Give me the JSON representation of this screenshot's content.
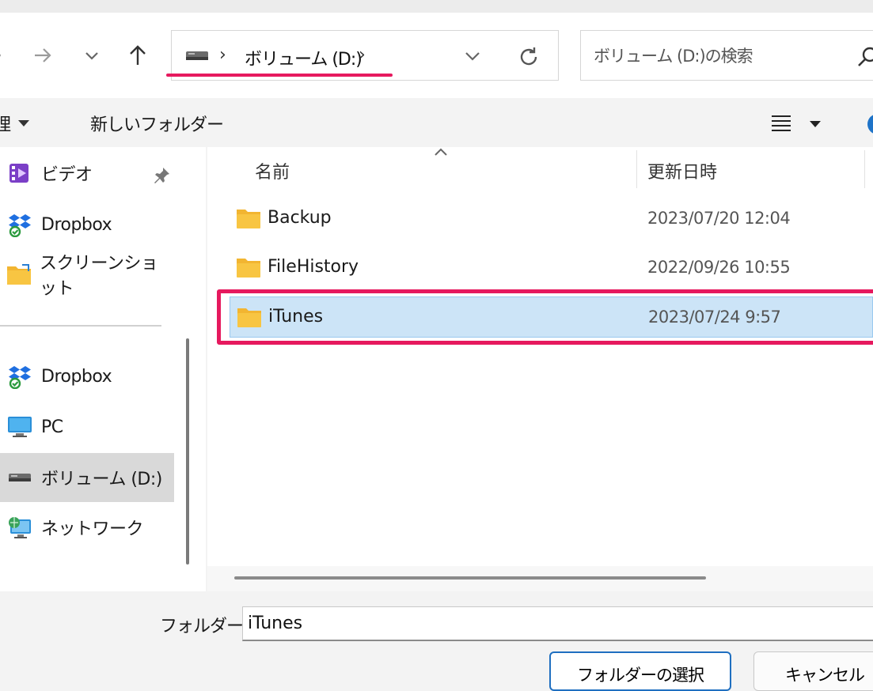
{
  "nav": {
    "back_icon": "arrow-left-icon",
    "forward_icon": "arrow-right-icon",
    "recent_icon": "chevron-down-icon",
    "up_icon": "arrow-up-icon",
    "address": {
      "drive_icon": "drive-icon",
      "separator": "›",
      "path": "ボリューム (D:)",
      "trailing_separator": "›"
    },
    "refresh_icon": "refresh-icon",
    "search": {
      "placeholder": "ボリューム (D:)の検索",
      "icon": "search-icon"
    }
  },
  "command_bar": {
    "organize_label": "理",
    "new_folder_label": "新しいフォルダー",
    "view_icon": "list-view-icon",
    "help_icon": "help-icon"
  },
  "sidebar": {
    "quick_access": [
      {
        "label": "ビデオ",
        "icon": "video-folder-icon",
        "pinned": true
      },
      {
        "label": "Dropbox",
        "icon": "dropbox-icon"
      },
      {
        "label": "スクリーンショット",
        "icon": "screenshot-folder-icon"
      }
    ],
    "locations": [
      {
        "label": "Dropbox",
        "icon": "dropbox-icon"
      },
      {
        "label": "PC",
        "icon": "pc-icon"
      },
      {
        "label": "ボリューム (D:)",
        "icon": "drive-icon",
        "selected": true
      },
      {
        "label": "ネットワーク",
        "icon": "network-icon"
      }
    ]
  },
  "file_list": {
    "columns": {
      "name": "名前",
      "modified": "更新日時"
    },
    "rows": [
      {
        "name": "Backup",
        "modified": "2023/07/20 12:04",
        "selected": false
      },
      {
        "name": "FileHistory",
        "modified": "2022/09/26 10:55",
        "selected": false
      },
      {
        "name": "iTunes",
        "modified": "2023/07/24 9:57",
        "selected": true
      }
    ]
  },
  "footer": {
    "folder_label": "フォルダー:",
    "folder_value": "iTunes",
    "select_button": "フォルダーの選択",
    "cancel_button": "キャンセル"
  },
  "colors": {
    "annotation": "#e6195e",
    "selection": "#cce4f7",
    "folder": "#f8c542"
  }
}
